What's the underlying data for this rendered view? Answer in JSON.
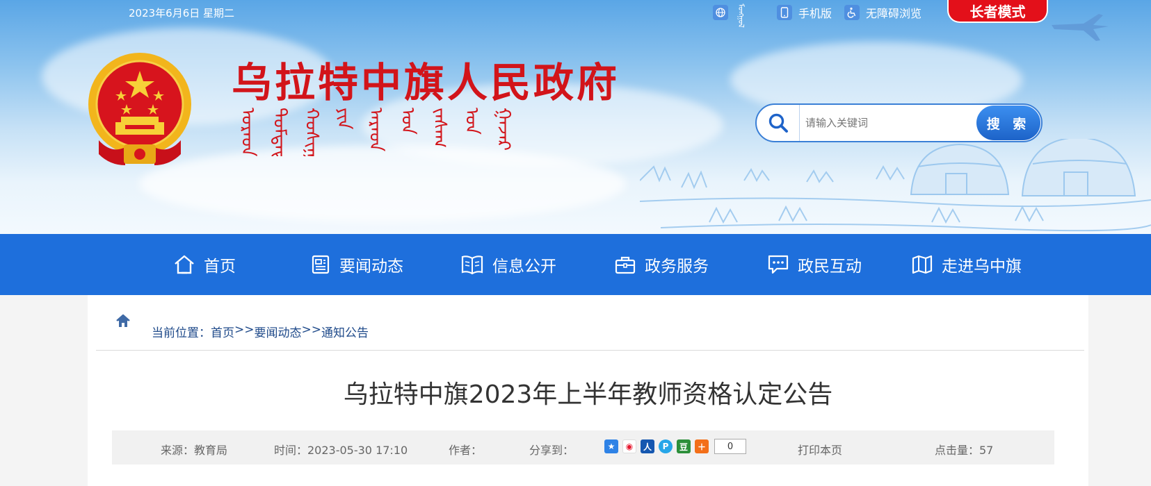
{
  "topbar": {
    "date": "2023年6月6日 星期二",
    "mongol_label": "ᠮᠣᠩᠭᠣᠯ",
    "mobile_label": "手机版",
    "accessible_label": "无障碍浏览",
    "elder_mode_label": "长者模式"
  },
  "header": {
    "site_title": "乌拉特中旗人民政府",
    "mongol_title": "ᠤᠷᠠᠳ ᠳᠤᠮᠳᠠᠳᠤ ᠬᠣᠰᠢᠭᠤ ᠶᠢᠨ ᠠᠷᠠᠳ ᠤᠨ ᠵᠠᠰᠠᠭ ᠤᠨ ᠭᠠᠵᠠᠷ"
  },
  "search": {
    "placeholder": "请输入关键词",
    "button_label": "搜 索"
  },
  "nav": {
    "items": [
      {
        "label": "首页",
        "icon": "home-icon"
      },
      {
        "label": "要闻动态",
        "icon": "news-icon"
      },
      {
        "label": "信息公开",
        "icon": "book-icon"
      },
      {
        "label": "政务服务",
        "icon": "briefcase-icon"
      },
      {
        "label": "政民互动",
        "icon": "chat-icon"
      },
      {
        "label": "走进乌中旗",
        "icon": "map-icon"
      }
    ]
  },
  "breadcrumb": {
    "prefix": "当前位置：",
    "items": [
      "首页",
      "要闻动态",
      "通知公告"
    ],
    "separator": ">>"
  },
  "article": {
    "title": "乌拉特中旗2023年上半年教师资格认定公告",
    "source": "来源：教育局",
    "time": "时间：2023-05-30 17:10",
    "author": "作者：",
    "share_label": "分享到：",
    "share_count": "0",
    "print_label": "打印本页",
    "views": "点击量：57"
  },
  "colors": {
    "nav_blue": "#1e6fdc",
    "title_red": "#d2141a",
    "elder_red": "#e3101a",
    "breadcrumb_blue": "#1f4a8a"
  }
}
